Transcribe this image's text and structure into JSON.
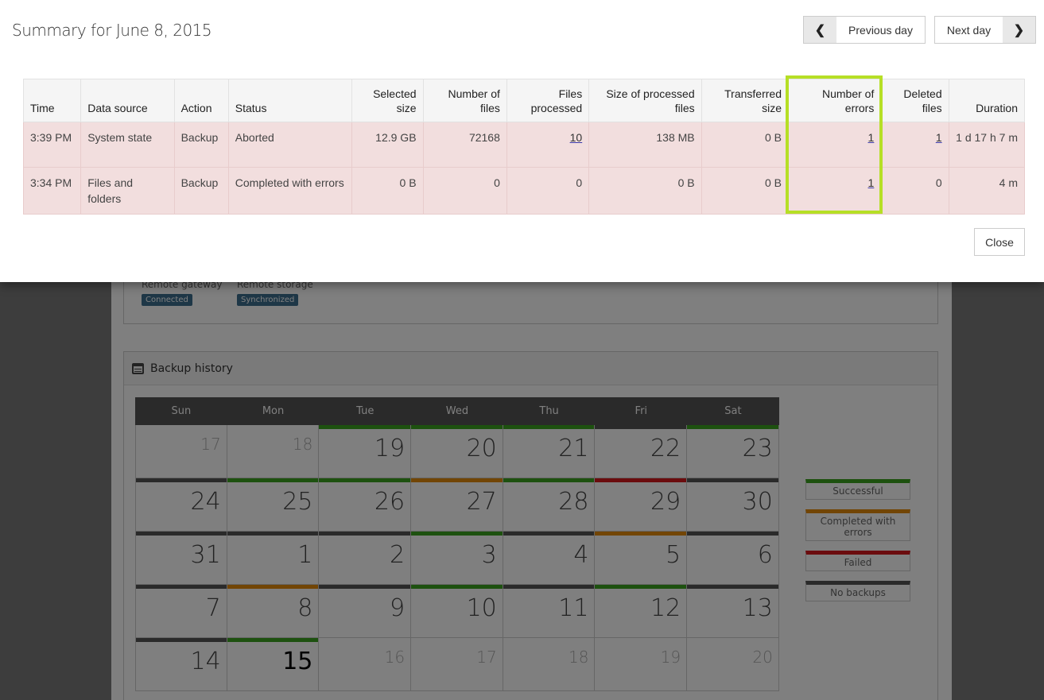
{
  "modal": {
    "title": "Summary for June 8, 2015",
    "prev_label": "Previous day",
    "next_label": "Next day",
    "close_label": "Close",
    "columns": [
      "Time",
      "Data source",
      "Action",
      "Status",
      "Selected size",
      "Number of files",
      "Files processed",
      "Size of processed files",
      "Transferred size",
      "Number of errors",
      "Deleted files",
      "Duration"
    ],
    "rows": [
      [
        "3:39 PM",
        "System state",
        "Backup",
        "Aborted",
        "12.9 GB",
        "72168",
        "10",
        "138 MB",
        "0 B",
        "1",
        "1",
        "1 d 17 h 7 m"
      ],
      [
        "3:34 PM",
        "Files and folders",
        "Backup",
        "Completed with errors",
        "0 B",
        "0",
        "0",
        "0 B",
        "0 B",
        "1",
        "0",
        "4 m"
      ]
    ]
  },
  "status": {
    "gateway_label": "Remote gateway",
    "gateway_badge": "Connected",
    "storage_label": "Remote storage",
    "storage_badge": "Synchronized"
  },
  "history": {
    "title": "Backup history",
    "weekdays": [
      "Sun",
      "Mon",
      "Tue",
      "Wed",
      "Thu",
      "Fri",
      "Sat"
    ],
    "weeks": [
      [
        {
          "d": "17",
          "s": "dim"
        },
        {
          "d": "18",
          "s": "dim"
        },
        {
          "d": "19",
          "s": "success"
        },
        {
          "d": "20",
          "s": "success"
        },
        {
          "d": "21",
          "s": "success"
        },
        {
          "d": "22",
          "s": "none"
        },
        {
          "d": "23",
          "s": "success"
        }
      ],
      [
        {
          "d": "24",
          "s": "none"
        },
        {
          "d": "25",
          "s": "success"
        },
        {
          "d": "26",
          "s": "success"
        },
        {
          "d": "27",
          "s": "errors"
        },
        {
          "d": "28",
          "s": "success"
        },
        {
          "d": "29",
          "s": "failed"
        },
        {
          "d": "30",
          "s": "none"
        }
      ],
      [
        {
          "d": "31",
          "s": "none"
        },
        {
          "d": "1",
          "s": "none"
        },
        {
          "d": "2",
          "s": "none"
        },
        {
          "d": "3",
          "s": "success"
        },
        {
          "d": "4",
          "s": "none"
        },
        {
          "d": "5",
          "s": "errors"
        },
        {
          "d": "6",
          "s": "none"
        }
      ],
      [
        {
          "d": "7",
          "s": "none"
        },
        {
          "d": "8",
          "s": "errors"
        },
        {
          "d": "9",
          "s": "none"
        },
        {
          "d": "10",
          "s": "success"
        },
        {
          "d": "11",
          "s": "none"
        },
        {
          "d": "12",
          "s": "success"
        },
        {
          "d": "13",
          "s": "none"
        }
      ],
      [
        {
          "d": "14",
          "s": "none"
        },
        {
          "d": "15",
          "s": "today"
        },
        {
          "d": "16",
          "s": "dim"
        },
        {
          "d": "17",
          "s": "dim"
        },
        {
          "d": "18",
          "s": "dim"
        },
        {
          "d": "19",
          "s": "dim"
        },
        {
          "d": "20",
          "s": "dim"
        }
      ]
    ],
    "legend": [
      {
        "label": "Successful",
        "color": "#3aa21f"
      },
      {
        "label": "Completed with errors",
        "color": "#e58a0b"
      },
      {
        "label": "Failed",
        "color": "#d7191c"
      },
      {
        "label": "No backups",
        "color": "#555555"
      }
    ],
    "status_colors": {
      "success": "#3aa21f",
      "errors": "#e58a0b",
      "failed": "#d7191c",
      "none": "#555555",
      "today": "#3aa21f"
    }
  }
}
